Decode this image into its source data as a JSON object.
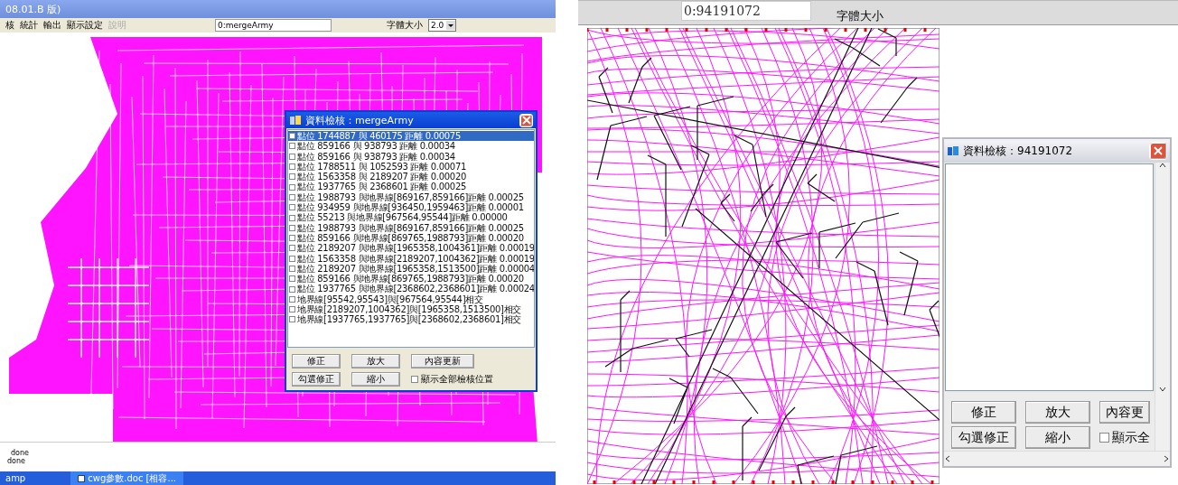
{
  "panes": [
    {
      "kind": "editor",
      "title": "08.01.B 版)",
      "menu": [
        {
          "label": "核",
          "disabled": false
        },
        {
          "label": "統計",
          "disabled": false
        },
        {
          "label": "輸出",
          "disabled": false
        },
        {
          "label": "顯示設定",
          "disabled": false
        },
        {
          "label": "說明",
          "disabled": true
        }
      ],
      "layer_field": {
        "value": "0:mergeArmy"
      },
      "font_size": {
        "label": "字體大小",
        "value": "2.0"
      },
      "dialog": {
        "kind": "classic",
        "title": "資料檢核：mergeArmy",
        "items": [
          {
            "text": "點位 1744887 與 460175 距離 0.00075",
            "checked": false,
            "selected": true
          },
          {
            "text": "點位 859166 與 938793 距離 0.00034",
            "checked": false,
            "selected": false
          },
          {
            "text": "點位 859166 與 938793 距離 0.00034",
            "checked": false,
            "selected": false
          },
          {
            "text": "點位 1788511 與 1052593 距離 0.00071",
            "checked": false,
            "selected": false
          },
          {
            "text": "點位 1563358 與 2189207 距離 0.00020",
            "checked": false,
            "selected": false
          },
          {
            "text": "點位 1937765 與 2368601 距離 0.00025",
            "checked": false,
            "selected": false
          },
          {
            "text": "點位 1988793 與地界線[869167,859166]距離 0.00025",
            "checked": false,
            "selected": false
          },
          {
            "text": "點位 934959 與地界線[936450,1959463]距離 0.00001",
            "checked": false,
            "selected": false
          },
          {
            "text": "點位 55213 與地界線[967564,95544]距離 0.00000",
            "checked": false,
            "selected": false
          },
          {
            "text": "點位 1988793 與地界線[869167,859166]距離 0.00025",
            "checked": false,
            "selected": false
          },
          {
            "text": "點位 859166 與地界線[869765,1988793]距離 0.00020",
            "checked": false,
            "selected": false
          },
          {
            "text": "點位 2189207 與地界線[1965358,1004361]距離 0.00019",
            "checked": false,
            "selected": false
          },
          {
            "text": "點位 1563358 與地界線[2189207,1004362]距離 0.00019",
            "checked": false,
            "selected": false
          },
          {
            "text": "點位 2189207 與地界線[1965358,1513500]距離 0.00004",
            "checked": false,
            "selected": false
          },
          {
            "text": "點位 859166 與地界線[869765,1988793]距離 0.00020",
            "checked": false,
            "selected": false
          },
          {
            "text": "點位 1937765 與地界線[2368602,2368601]距離 0.00024",
            "checked": false,
            "selected": false
          },
          {
            "text": "地界線[95542,95543]與[967564,95544]相交",
            "checked": false,
            "selected": false
          },
          {
            "text": "地界線[2189207,1004362]與[1965358,1513500]相交",
            "checked": false,
            "selected": false
          },
          {
            "text": "地界線[1937765,1937765]與[2368602,2368601]相交",
            "checked": false,
            "selected": false
          }
        ],
        "buttons": [
          "修正",
          "放大",
          "內容更新",
          "勾選修正",
          "縮小"
        ],
        "show_all": {
          "label": "顯示全部檢核位置",
          "checked": false
        }
      },
      "status_lines": [
        "done",
        "done"
      ],
      "taskbar": [
        "amp",
        "cwg參數.doc [相容..."
      ]
    },
    {
      "kind": "viewer",
      "layer_field": {
        "value": "0:94191072"
      },
      "font_size": {
        "label": "字體大小"
      },
      "dialog": {
        "kind": "modern",
        "title": "資料檢核：94191072",
        "buttons": [
          "修正",
          "放大",
          "內容更",
          "勾選修正",
          "縮小"
        ],
        "show_all": {
          "label": "顯示全",
          "checked": false
        }
      }
    }
  ]
}
